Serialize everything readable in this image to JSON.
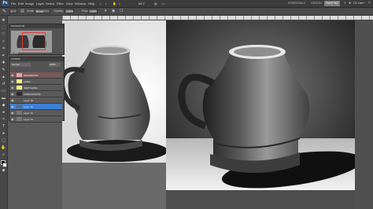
{
  "menubar": {
    "app_icon": "Ps",
    "items": [
      "File",
      "Edit",
      "Image",
      "Layer",
      "Select",
      "Filter",
      "View",
      "Window",
      "Help"
    ],
    "zoom": "66.7",
    "workspaces": [
      "ESSENTIALS",
      "DESIGN",
      "PAINTING"
    ],
    "cs_live": "CS Live"
  },
  "options": {
    "mode_label": "Mode:",
    "mode_value": "Brush",
    "opacity_label": "Opacity:",
    "opacity_value": "100%",
    "flow_label": "Flow:",
    "flow_value": "100%"
  },
  "navigator": {
    "tab": "NAVIGATOR",
    "zoom": "66.67%"
  },
  "layers": {
    "tab": "LAYERS",
    "blend": "Normal",
    "opacity": "100%",
    "items": [
      {
        "name": "REFERENCE"
      },
      {
        "name": "LINES"
      },
      {
        "name": "SKETCHING"
      },
      {
        "name": "FOREGROUND"
      },
      {
        "name": "Layer 1S"
      },
      {
        "name": "Layer 4S"
      },
      {
        "name": "Layer 1S"
      },
      {
        "name": "Layer 1S"
      }
    ]
  },
  "colors": {
    "accent": "#e03a3a",
    "selected": "#3d7fd6",
    "reference_tag": "#e8a0a0",
    "lines_tag": "#f5f08a"
  },
  "icons": {
    "tools": [
      "move-icon",
      "marquee-icon",
      "lasso-icon",
      "wand-icon",
      "crop-icon",
      "eyedropper-icon",
      "healing-icon",
      "brush-icon",
      "stamp-icon",
      "history-brush-icon",
      "eraser-icon",
      "gradient-icon",
      "blur-icon",
      "dodge-icon",
      "pen-icon",
      "type-icon",
      "path-select-icon",
      "shape-icon",
      "hand-icon",
      "zoom-icon"
    ]
  }
}
